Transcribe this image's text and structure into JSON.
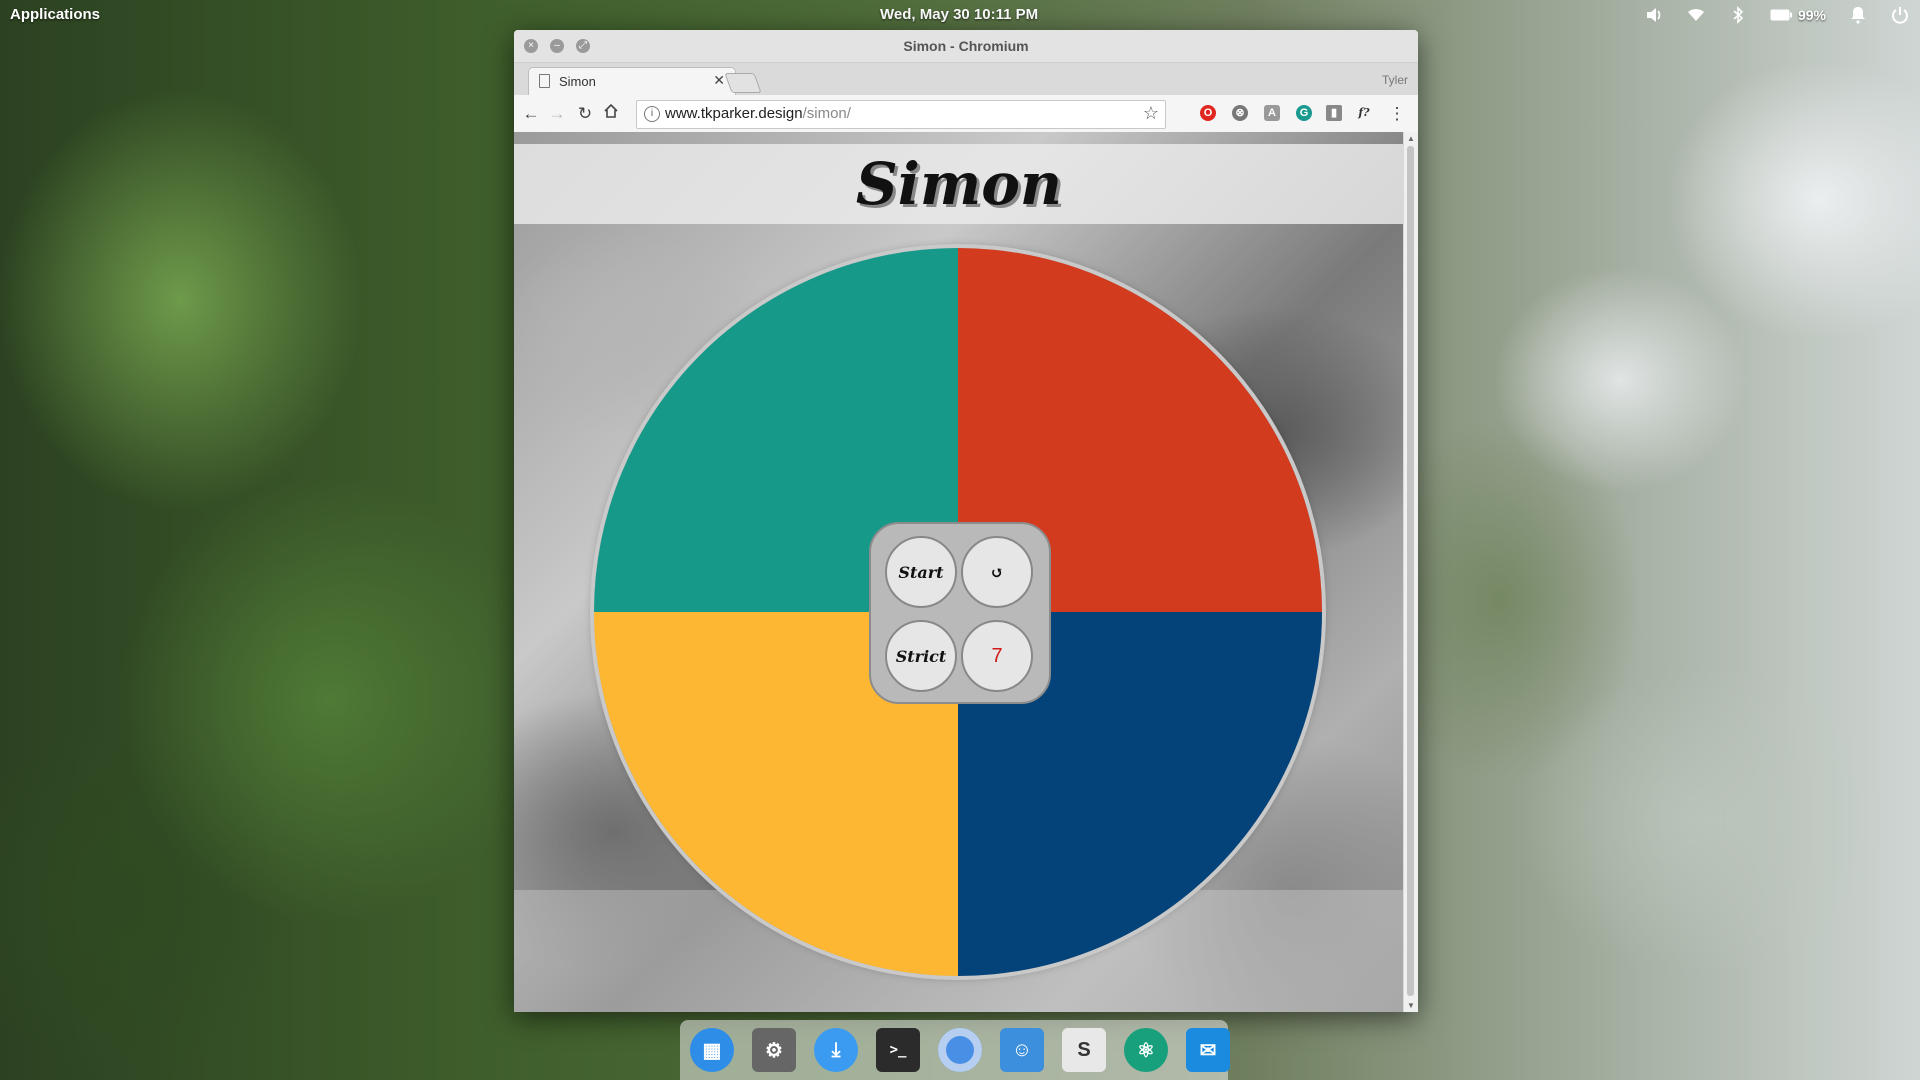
{
  "top_panel": {
    "applications_label": "Applications",
    "datetime": "Wed, May 30   10:11 PM",
    "battery_percent": "99%",
    "tray_icons": [
      "volume-icon",
      "wifi-icon",
      "bluetooth-icon",
      "battery-icon",
      "notifications-icon",
      "power-icon"
    ]
  },
  "window": {
    "title": "Simon - Chromium",
    "profile_name": "Tyler"
  },
  "tab": {
    "title": "Simon"
  },
  "omnibox": {
    "url_host": "www.tkparker.design",
    "url_path": "/simon/"
  },
  "page": {
    "title": "Simon",
    "colors": {
      "green": "#17998a",
      "red": "#d33b1f",
      "yellow": "#fdb732",
      "blue": "#03437a"
    },
    "controls": {
      "start_label": "Start",
      "reset_label": "↺",
      "strict_label": "Strict",
      "count": "7",
      "count_color": "#d11a1a"
    }
  },
  "dock": {
    "apps": [
      "multitasking-view",
      "system-settings",
      "appcenter",
      "terminal",
      "chromium",
      "files",
      "slack",
      "atom",
      "mail"
    ]
  }
}
